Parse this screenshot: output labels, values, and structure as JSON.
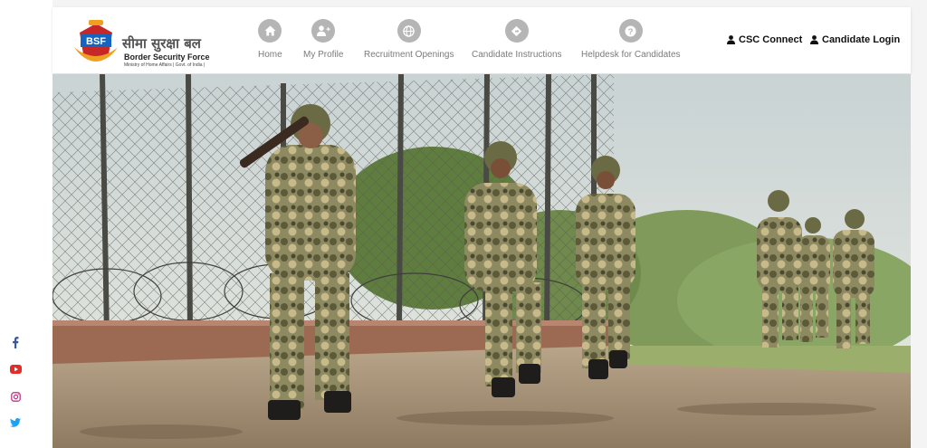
{
  "brand": {
    "hindi_name": "सीमा सुरक्षा बल",
    "english_name": "Border Security Force",
    "ministry_line": "Ministry of Home Affairs | Govt. of India |",
    "emblem_text": "BSF"
  },
  "nav": {
    "items": [
      {
        "label": "Home",
        "icon": "home-icon"
      },
      {
        "label": "My Profile",
        "icon": "user-plus-icon"
      },
      {
        "label": "Recruitment Openings",
        "icon": "globe-icon"
      },
      {
        "label": "Candidate Instructions",
        "icon": "direction-sign-icon"
      },
      {
        "label": "Helpdesk for Candidates",
        "icon": "question-icon"
      }
    ]
  },
  "auth": {
    "csc_connect": "CSC Connect",
    "candidate_login": "Candidate Login"
  },
  "social": [
    "facebook-icon",
    "youtube-icon",
    "instagram-icon",
    "twitter-icon"
  ],
  "colors": {
    "nav_icon_bg": "#b5b5b5",
    "nav_label": "#7b7b7b",
    "facebook": "#3b5998",
    "youtube": "#e52d27",
    "instagram": "#c13584",
    "twitter": "#1da1f2"
  },
  "hero": {
    "image": "soldiers-patrolling-border-fence"
  }
}
